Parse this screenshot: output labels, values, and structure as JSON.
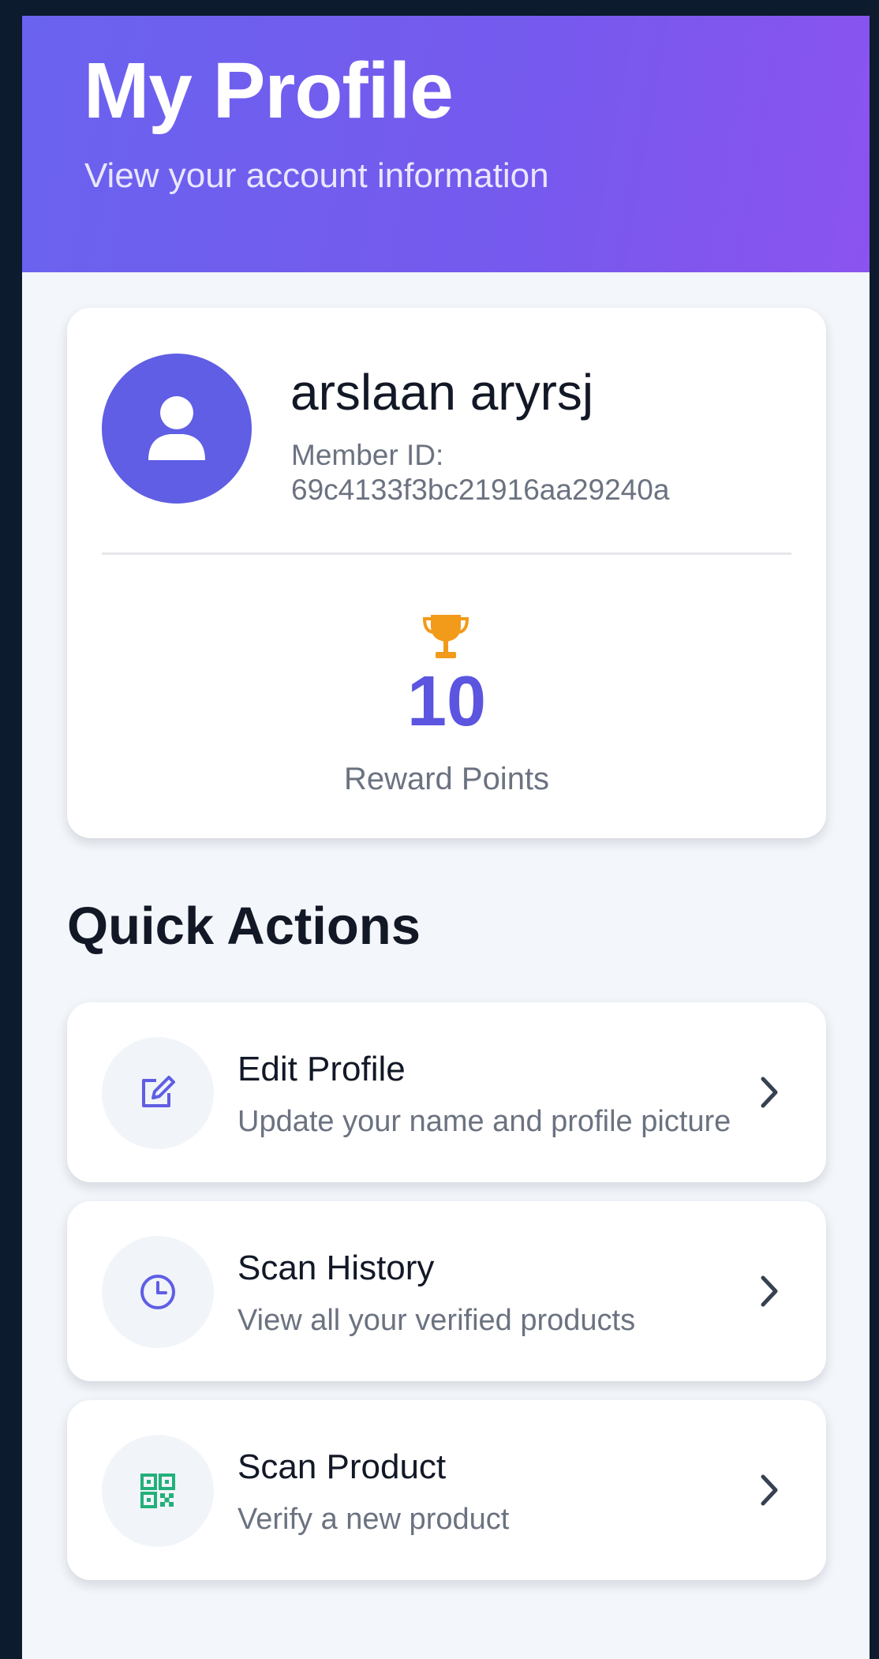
{
  "header": {
    "title": "My Profile",
    "subtitle": "View your account information"
  },
  "profile": {
    "name": "arslaan aryrsj",
    "member_id_label": "Member ID:",
    "member_id": "69c4133f3bc21916aa29240a",
    "avatar_icon": "user-icon",
    "reward_icon": "trophy-icon",
    "reward_points": "10",
    "reward_label": "Reward Points"
  },
  "quick_actions": {
    "title": "Quick Actions",
    "items": [
      {
        "title": "Edit Profile",
        "description": "Update your name and profile picture",
        "icon": "edit-icon"
      },
      {
        "title": "Scan History",
        "description": "View all your verified products",
        "icon": "clock-icon"
      },
      {
        "title": "Scan Product",
        "description": "Verify a new product",
        "icon": "qr-code-icon"
      }
    ]
  },
  "colors": {
    "header_gradient_start": "#6a63ef",
    "header_gradient_end": "#8b53ef",
    "accent": "#5b55e0",
    "trophy": "#f29a1a",
    "qr_icon": "#22b07a",
    "background": "#f3f6fa"
  }
}
